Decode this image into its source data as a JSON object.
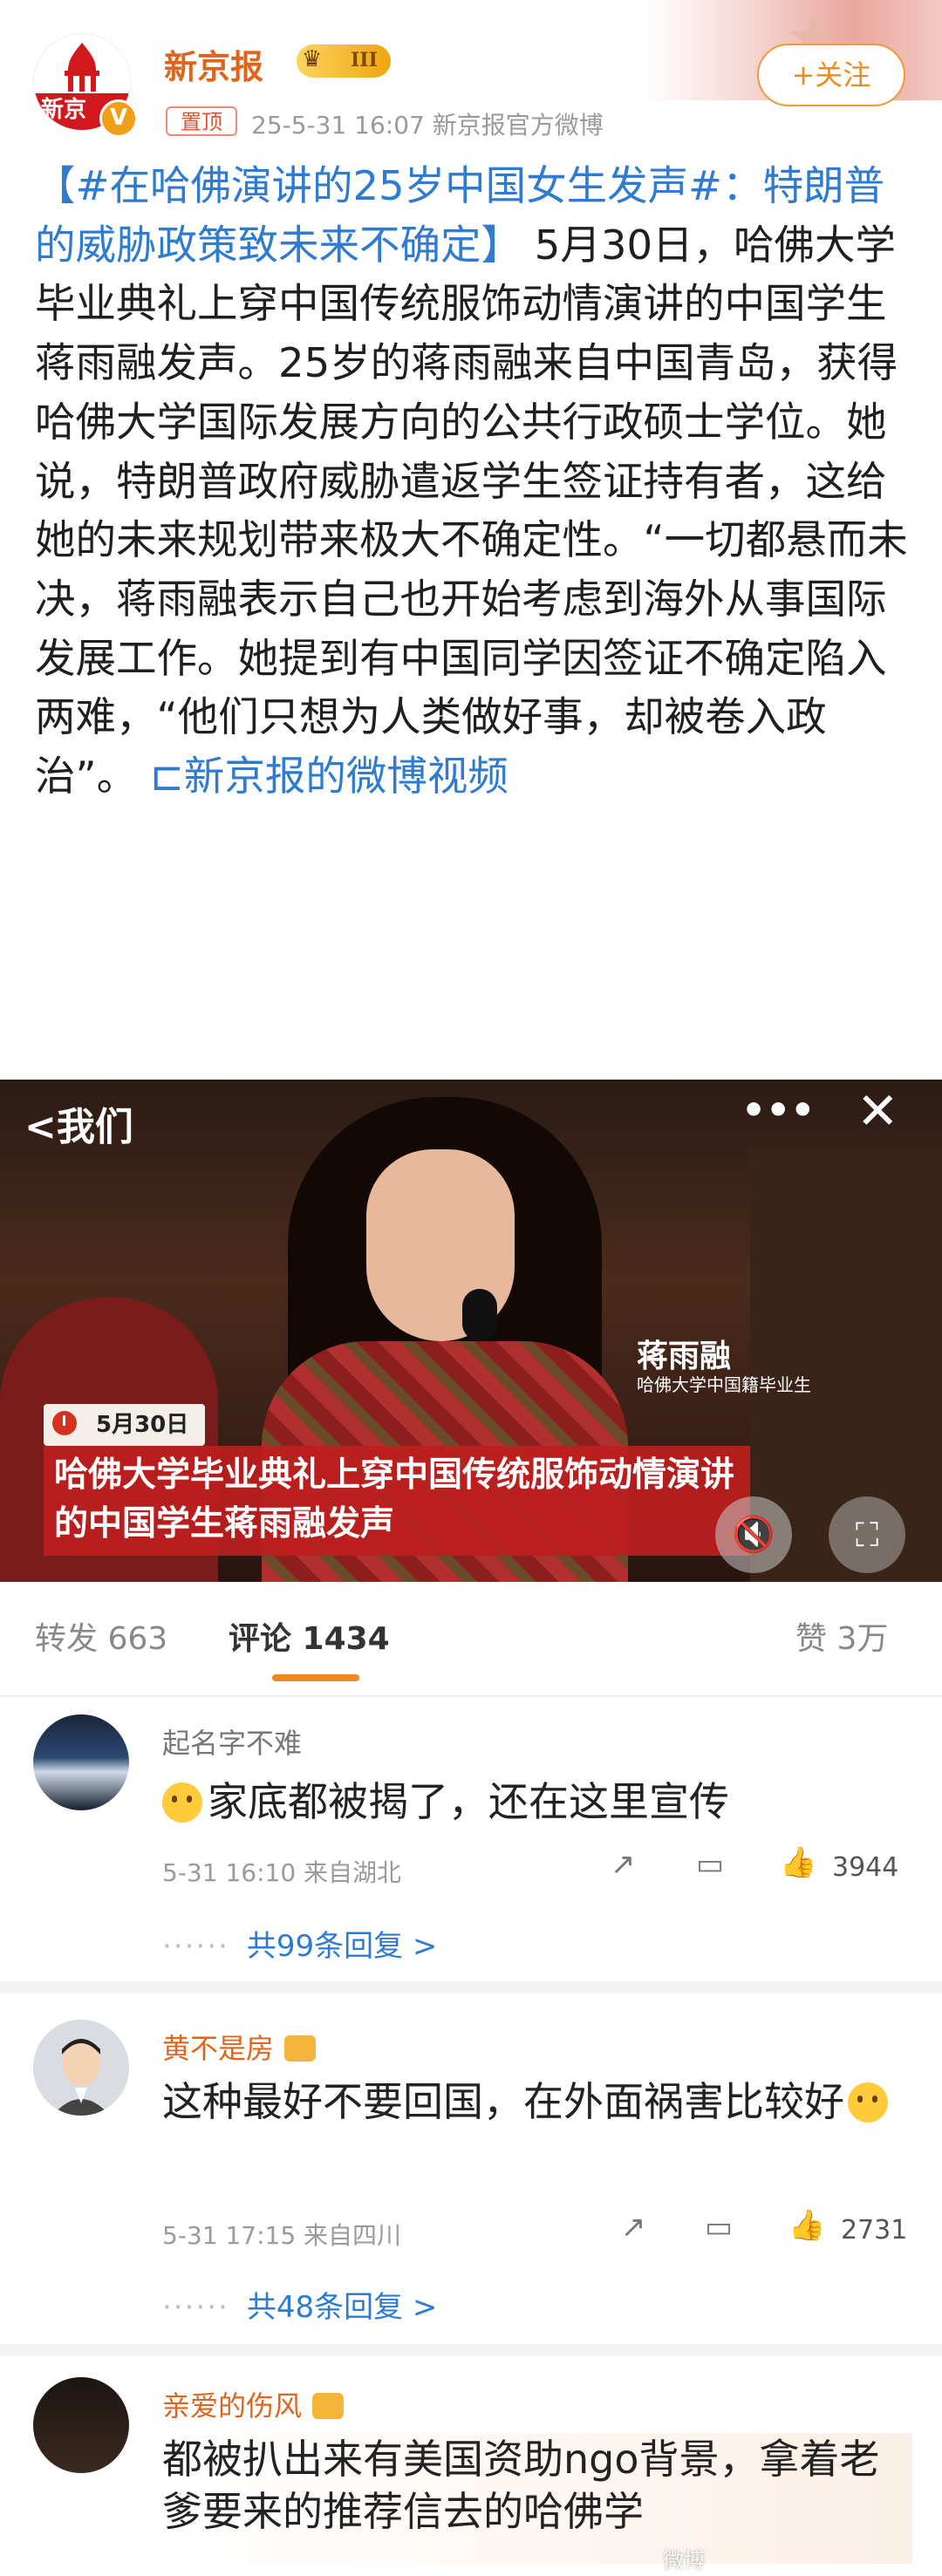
{
  "header": {
    "account_name": "新京报",
    "avatar_text": "新京",
    "level_badge": "III",
    "verified_mark": "V",
    "pin_label": "置顶",
    "meta": "25-5-31 16:07  新京报官方微博",
    "follow_label": "+关注"
  },
  "post": {
    "topic": "【#在哈佛演讲的25岁中国女生发声#：特朗普的威胁政策致未来不确定】",
    "body": "5月30日，哈佛大学毕业典礼上穿中国传统服饰动情演讲的中国学生蒋雨融发声。25岁的蒋雨融来自中国青岛，获得哈佛大学国际发展方向的公共行政硕士学位。她说，特朗普政府威胁遣返学生签证持有者，这给她的未来规划带来极大不确定性。“一切都悬而未决，蒋雨融表示自己也开始考虑到海外从事国际发展工作。她提到有中国同学因签证不确定陷入两难，“他们只想为人类做好事，却被卷入政治”。",
    "video_link": "新京报的微博视频"
  },
  "video": {
    "logo": "<我们",
    "more_icon": "•••",
    "close_icon": "✕",
    "speaker_name": "蒋雨融",
    "speaker_title": "哈佛大学中国籍毕业生",
    "date_tag": "5月30日",
    "caption": "哈佛大学毕业典礼上穿中国传统服饰动情演讲的中国学生蒋雨融发声"
  },
  "tabs": {
    "repost": "转发 663",
    "comments": "评论 1434",
    "likes": "赞 3万"
  },
  "comments": [
    {
      "user": "起名字不难",
      "text": "家底都被揭了，还在这里宣传",
      "meta": "5-31 16:10  来自湖北",
      "likes": "3944",
      "replies": "共99条回复 >"
    },
    {
      "user": "黄不是房",
      "text": "这种最好不要回国，在外面祸害比较好",
      "meta": "5-31 17:15  来自四川",
      "likes": "2731",
      "replies": "共48条回复 >"
    },
    {
      "user": "亲爱的伤风",
      "text": "都被扒出来有美国资助ngo背景，拿着老爹要来的推荐信去的哈佛学"
    }
  ],
  "colors": {
    "accent": "#f18a1e",
    "link": "#2e7bcf",
    "brand_red": "#d2171d",
    "vip_name": "#e0651c"
  }
}
